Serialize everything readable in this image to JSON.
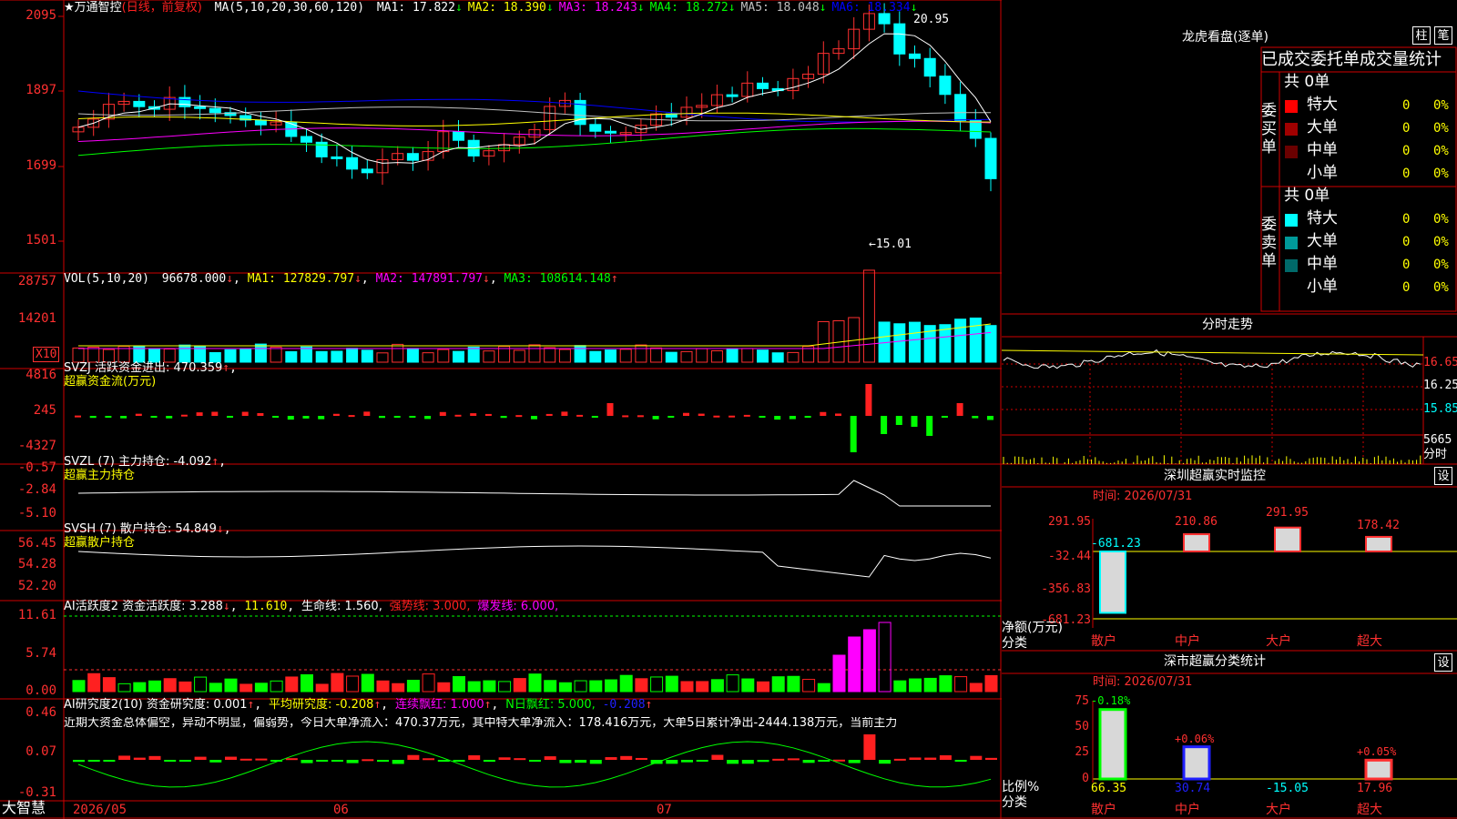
{
  "stock": {
    "name": "万通智控",
    "mode": "(日线，前复权)",
    "params": "MA(5,10,20,30,60,120)",
    "ma": [
      {
        "label": "MA1: 17.822",
        "arrow": "↓",
        "color": "#ffffff"
      },
      {
        "label": "MA2: 18.390",
        "arrow": "↓",
        "color": "#ffff00"
      },
      {
        "label": "MA3: 18.243",
        "arrow": "↓",
        "color": "#ff00ff"
      },
      {
        "label": "MA4: 18.272",
        "arrow": "↓",
        "color": "#00ff00"
      },
      {
        "label": "MA5: 18.048",
        "arrow": "↓",
        "color": "#c0c0c0"
      },
      {
        "label": "MA6: 18.334",
        "arrow": "↓",
        "color": "#0000ff"
      }
    ]
  },
  "price_axis": [
    "2095",
    "1897",
    "1699",
    "1501"
  ],
  "price_annot": {
    "high": "20.95",
    "low": "←15.01"
  },
  "vol": {
    "header": "VOL(5,10,20)",
    "value": "96678.000",
    "ma1": "MA1: 127829.797",
    "ma2": "MA2: 147891.797",
    "ma3": "MA3: 108614.148",
    "axis": [
      "28757",
      "14201"
    ],
    "unit": "X10"
  },
  "svzj": {
    "header": "SVZJ  活跃资金进出: 470.359",
    "sub": "超赢资金流(万元)",
    "axis": [
      "4816",
      "245",
      "-4327"
    ]
  },
  "svzl": {
    "header": "SVZL (7) 主力持仓: -4.092",
    "sub": "超赢主力持仓",
    "axis": [
      "-0.57",
      "-2.84",
      "-5.10"
    ]
  },
  "svsh": {
    "header": "SVSH (7) 散户持仓: 54.849",
    "sub": "超赢散户持仓",
    "axis": [
      "56.45",
      "54.28",
      "52.20"
    ]
  },
  "ai1": {
    "header": "AI活跃度2 资金活跃度: 3.288",
    "v2": "11.610",
    "v3": "生命线: 1.560,",
    "v4": "强势线: 3.000,",
    "v5": "爆发线: 6.000,",
    "axis": [
      "11.61",
      "5.74",
      "0.00"
    ]
  },
  "ai2": {
    "header": "AI研究度2(10) 资金研究度: 0.001",
    "v2": "平均研究度: -0.208",
    "v3": "连续飘红: 1.000",
    "v4": "N日飘红: 5.000,",
    "v5": "-0.208",
    "text": "近期大资金总体偏空，异动不明显，偏弱势，今日大单净流入：470.37万元，其中特大单净流入：178.416万元，大单5日累计净出-2444.138万元，当前主力",
    "axis": [
      "0.46",
      "0.07",
      "-0.31"
    ]
  },
  "dates": {
    "brand": "大智慧",
    "d1": "2026/05",
    "d2": "06",
    "d3": "07"
  },
  "lhb": {
    "title": "龙虎看盘(逐单)",
    "btn1": "柱",
    "btn2": "笔",
    "header": "已成交委托单成交量统计",
    "buy": {
      "label": "委买单",
      "total": "共 0单",
      "rows": [
        {
          "name": "特大",
          "v": "0",
          "p": "0%",
          "color": "#ff0000"
        },
        {
          "name": "大单",
          "v": "0",
          "p": "0%",
          "color": "#a00000"
        },
        {
          "name": "中单",
          "v": "0",
          "p": "0%",
          "color": "#6a0000"
        },
        {
          "name": "小单",
          "v": "0",
          "p": "0%",
          "color": "#000000"
        }
      ]
    },
    "sell": {
      "label": "委卖单",
      "total": "共 0单",
      "rows": [
        {
          "name": "特大",
          "v": "0",
          "p": "0%",
          "color": "#00ffff"
        },
        {
          "name": "大单",
          "v": "0",
          "p": "0%",
          "color": "#009a9a"
        },
        {
          "name": "中单",
          "v": "0",
          "p": "0%",
          "color": "#006a6a"
        },
        {
          "name": "小单",
          "v": "0",
          "p": "0%",
          "color": "#000000"
        }
      ]
    }
  },
  "fenshi": {
    "title": "分时走势",
    "axis": [
      "16.65",
      "16.25",
      "15.85",
      "5665",
      "分时"
    ]
  },
  "sz_monitor": {
    "title": "深圳超赢实时监控",
    "btn": "设",
    "time": "时间: 2026/07/31",
    "axis": [
      "291.95",
      "-32.44",
      "-356.83",
      "-681.23"
    ],
    "ylabel": "净额(万元)",
    "xlabel": "分类",
    "categories": [
      "散户",
      "中户",
      "大户",
      "超大"
    ],
    "values": [
      -681.23,
      210.86,
      291.95,
      178.42
    ],
    "value_labels": [
      "-681.23",
      "210.86",
      "291.95",
      "178.42"
    ]
  },
  "sz_class": {
    "title": "深市超赢分类统计",
    "btn": "设",
    "time": "时间: 2026/07/31",
    "axis": [
      "75",
      "50",
      "25",
      "0"
    ],
    "ylabel": "比例%",
    "xlabel": "分类",
    "categories": [
      "散户",
      "中户",
      "大户",
      "超大"
    ],
    "top_labels": [
      "-0.18%",
      "+0.06%",
      "",
      "+0.05%"
    ],
    "values": [
      66.35,
      30.74,
      -15.05,
      17.96
    ],
    "value_labels": [
      "66.35",
      "30.74",
      "-15.05",
      "17.96"
    ]
  }
}
